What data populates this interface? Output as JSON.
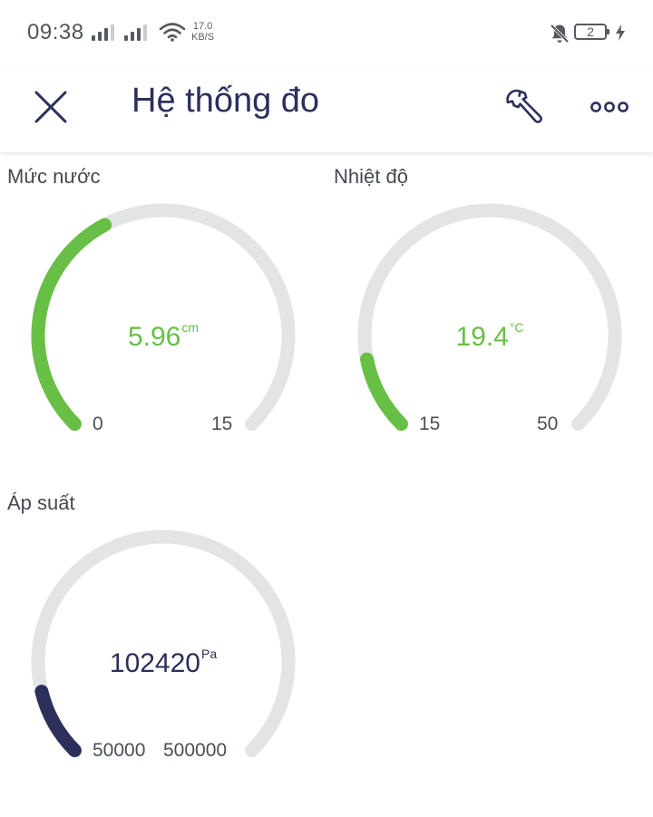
{
  "status_bar": {
    "time": "09:38",
    "net_speed_value": "17.0",
    "net_speed_unit": "KB/S",
    "battery_level": "2"
  },
  "header": {
    "title": "Hệ thống đo"
  },
  "colors": {
    "track": "#e3e4e5",
    "green": "#67bf45",
    "navy": "#2b2f5a"
  },
  "gauges": [
    {
      "label": "Mức nước",
      "value": "5.96",
      "unit": "cm",
      "min": "0",
      "max": "15",
      "fraction": 0.397,
      "color": "#67bf45"
    },
    {
      "label": "Nhiệt độ",
      "value": "19.4",
      "unit": "°C",
      "min": "15",
      "max": "50",
      "fraction": 0.126,
      "color": "#67bf45"
    },
    {
      "label": "Áp suất",
      "value": "102420",
      "unit": "Pa",
      "min": "50000",
      "max": "500000",
      "fraction": 0.116,
      "color": "#2b2f5a"
    }
  ]
}
